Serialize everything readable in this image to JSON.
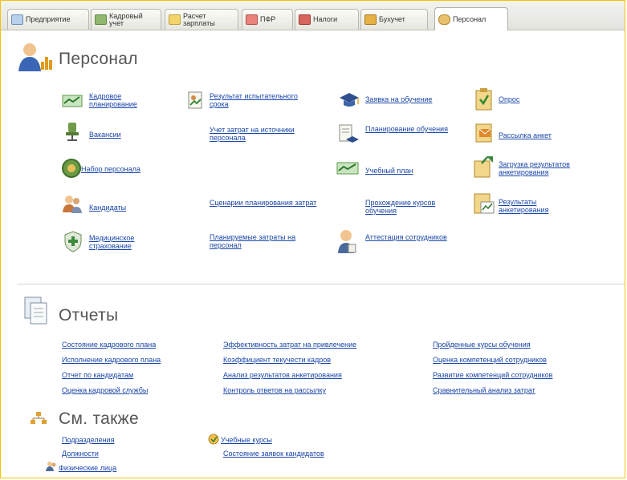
{
  "tabs": [
    {
      "label": "Предприятие"
    },
    {
      "label": "Кадровый учет"
    },
    {
      "label": "Расчет зарплаты"
    },
    {
      "label": "ПФР"
    },
    {
      "label": "Налоги"
    },
    {
      "label": "Бухучет"
    },
    {
      "label": "Персонал"
    }
  ],
  "personnel": {
    "title": "Персонал",
    "items": [
      {
        "label": "Кадровое планирование",
        "icon": "staffing-plan-icon"
      },
      {
        "label": "Вакансии",
        "icon": "chair-icon"
      },
      {
        "label": "Набор персонала",
        "icon": "recruitment-icon"
      },
      {
        "label": "Кандидаты",
        "icon": "candidates-icon"
      },
      {
        "label": "Медицинское страхование",
        "icon": "medical-insurance-icon"
      },
      {
        "label": "Результат испытательного срока",
        "icon": "probation-result-icon"
      },
      {
        "label": "Учет затрат на источники персонала",
        "icon": ""
      },
      {
        "label": "Сценарии планирования затрат",
        "icon": ""
      },
      {
        "label": "Планируемые затраты на персонал",
        "icon": ""
      },
      {
        "label": "Заявка на обучение",
        "icon": "graduation-cap-icon"
      },
      {
        "label": "Планирование обучения",
        "icon": "training-plan-icon"
      },
      {
        "label": "Учебный план",
        "icon": "curriculum-icon"
      },
      {
        "label": "Прохождение курсов обучения",
        "icon": ""
      },
      {
        "label": "Аттестация сотрудников",
        "icon": "attestation-icon"
      },
      {
        "label": "Опрос",
        "icon": "survey-icon"
      },
      {
        "label": "Рассылка анкет",
        "icon": "questionnaire-mailing-icon"
      },
      {
        "label": "Загрузка результатов анкетирования",
        "icon": "load-results-icon"
      },
      {
        "label": "Результаты анкетирования",
        "icon": "survey-results-icon"
      }
    ]
  },
  "reports": {
    "title": "Отчеты",
    "col1": [
      "Состояние кадрового плана",
      "Исполнение кадрового плана",
      "Отчет по кандидатам",
      "Оценка кадровой службы"
    ],
    "col2": [
      "Эффективность затрат на привлечение",
      "Коэффициент текучести кадров",
      "Анализ результатов анкетирования",
      "Контроль ответов на рассылку"
    ],
    "col3": [
      "Пройденные курсы обучения",
      "Оценка компетенций сотрудников",
      "Развитие компетенций сотрудников",
      "Сравнительный анализ затрат"
    ]
  },
  "see_also": {
    "title": "См. также",
    "items": [
      "Подразделения",
      "Должности",
      "Физические лица",
      "Учебные курсы",
      "Состояние заявок кандидатов"
    ]
  }
}
